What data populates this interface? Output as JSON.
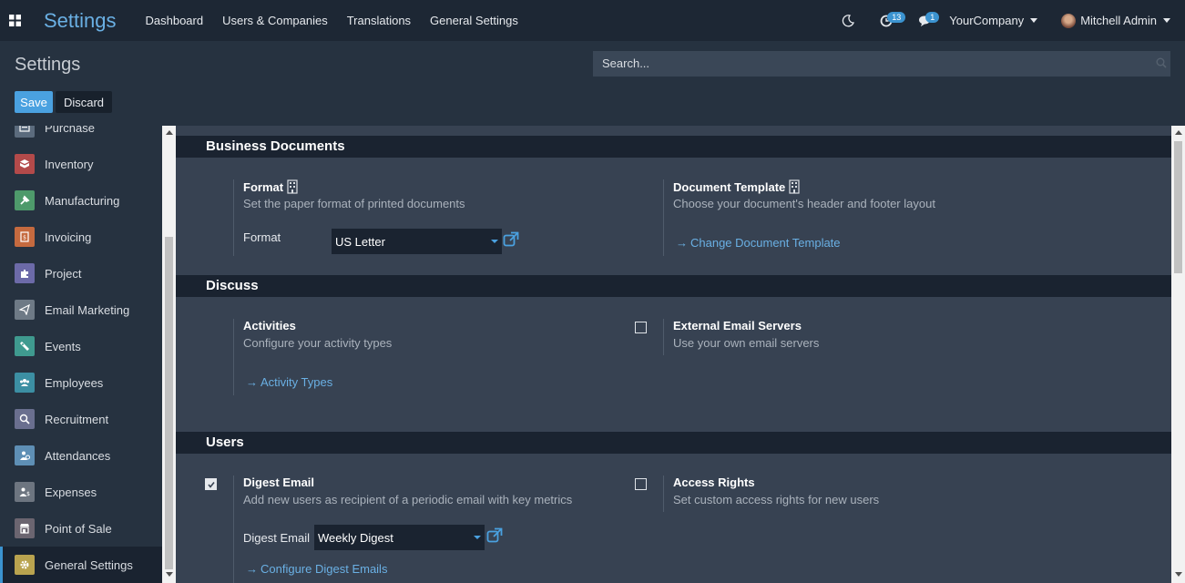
{
  "navbar": {
    "brand": "Settings",
    "menu": [
      "Dashboard",
      "Users & Companies",
      "Translations",
      "General Settings"
    ],
    "activity_count": "13",
    "message_count": "1",
    "company": "YourCompany",
    "user": "Mitchell Admin"
  },
  "control": {
    "title": "Settings",
    "search_placeholder": "Search...",
    "save_label": "Save",
    "discard_label": "Discard"
  },
  "sidebar": {
    "items": [
      {
        "label": "Purchase",
        "icon": "purchase-icon",
        "color": "#5b6b7d"
      },
      {
        "label": "Inventory",
        "icon": "inventory-icon",
        "color": "#b34a4a"
      },
      {
        "label": "Manufacturing",
        "icon": "manufacturing-icon",
        "color": "#4e9a6b"
      },
      {
        "label": "Invoicing",
        "icon": "invoicing-icon",
        "color": "#c56a3f"
      },
      {
        "label": "Project",
        "icon": "project-icon",
        "color": "#6c6aa8"
      },
      {
        "label": "Email Marketing",
        "icon": "email-marketing-icon",
        "color": "#6e7a86"
      },
      {
        "label": "Events",
        "icon": "events-icon",
        "color": "#3f9a8f"
      },
      {
        "label": "Employees",
        "icon": "employees-icon",
        "color": "#3c8fa3"
      },
      {
        "label": "Recruitment",
        "icon": "recruitment-icon",
        "color": "#6a6f8f"
      },
      {
        "label": "Attendances",
        "icon": "attendances-icon",
        "color": "#5e8fb5"
      },
      {
        "label": "Expenses",
        "icon": "expenses-icon",
        "color": "#6d7580"
      },
      {
        "label": "Point of Sale",
        "icon": "point-of-sale-icon",
        "color": "#6b6570"
      },
      {
        "label": "General Settings",
        "icon": "gear-icon",
        "color": "#b9a34f"
      }
    ],
    "active": "General Settings"
  },
  "sections": {
    "business_documents": {
      "title": "Business Documents",
      "format_title": "Format",
      "format_desc": "Set the paper format of printed documents",
      "format_label": "Format",
      "format_value": "US Letter",
      "template_title": "Document Template",
      "template_desc": "Choose your document's header and footer layout",
      "template_link": "Change Document Template"
    },
    "discuss": {
      "title": "Discuss",
      "activities_title": "Activities",
      "activities_desc": "Configure your activity types",
      "activities_link": "Activity Types",
      "external_title": "External Email Servers",
      "external_desc": "Use your own email servers",
      "external_checked": false
    },
    "users": {
      "title": "Users",
      "digest_title": "Digest Email",
      "digest_desc": "Add new users as recipient of a periodic email with key metrics",
      "digest_checked": true,
      "digest_label": "Digest Email",
      "digest_value": "Weekly Digest",
      "digest_link": "Configure Digest Emails",
      "access_title": "Access Rights",
      "access_desc": "Set custom access rights for new users",
      "access_checked": false
    }
  }
}
